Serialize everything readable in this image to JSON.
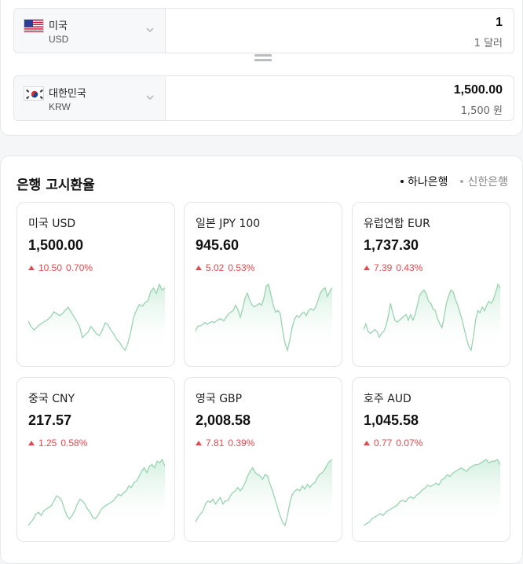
{
  "converter": {
    "from": {
      "name": "미국",
      "code": "USD",
      "flag": "us-flag-icon",
      "amount": "1",
      "amount_text": "1 달러"
    },
    "to": {
      "name": "대한민국",
      "code": "KRW",
      "flag": "kr-flag-icon",
      "amount": "1,500.00",
      "amount_text": "1,500 원"
    }
  },
  "rates": {
    "title": "은행 고시환율",
    "banks": [
      {
        "label": "하나은행",
        "active": true
      },
      {
        "label": "신한은행",
        "active": false
      }
    ],
    "cards": [
      {
        "name": "미국 USD",
        "value": "1,500.00",
        "change": "10.50",
        "pct": "0.70%",
        "series": [
          40,
          34,
          30,
          33,
          36,
          38,
          40,
          42,
          45,
          50,
          48,
          46,
          48,
          52,
          55,
          50,
          45,
          40,
          34,
          22,
          25,
          28,
          34,
          30,
          26,
          24,
          30,
          38,
          36,
          30,
          26,
          20,
          17,
          12,
          8,
          16,
          28,
          44,
          52,
          58,
          56,
          60,
          62,
          72,
          76,
          70,
          80,
          74,
          76
        ]
      },
      {
        "name": "일본 JPY 100",
        "value": "945.60",
        "change": "5.02",
        "pct": "0.53%",
        "series": [
          30,
          36,
          36,
          38,
          40,
          38,
          40,
          41,
          40,
          42,
          44,
          44,
          42,
          46,
          50,
          52,
          54,
          60,
          55,
          46,
          56,
          68,
          74,
          66,
          60,
          58,
          60,
          62,
          60,
          68,
          82,
          84,
          72,
          60,
          52,
          54,
          50,
          30,
          16,
          8,
          20,
          34,
          44,
          48,
          46,
          50,
          52,
          48,
          54,
          56,
          54,
          58,
          66,
          74,
          78,
          80,
          70,
          76,
          80
        ]
      },
      {
        "name": "유럽연합 EUR",
        "value": "1,737.30",
        "change": "7.39",
        "pct": "0.43%",
        "series": [
          30,
          36,
          28,
          26,
          28,
          30,
          28,
          22,
          26,
          28,
          34,
          44,
          58,
          48,
          40,
          38,
          40,
          42,
          44,
          46,
          40,
          46,
          40,
          46,
          56,
          66,
          70,
          72,
          68,
          60,
          58,
          52,
          50,
          42,
          36,
          32,
          44,
          58,
          66,
          72,
          70,
          62,
          56,
          48,
          40,
          30,
          20,
          12,
          8,
          22,
          40,
          50,
          48,
          54,
          50,
          56,
          60,
          58,
          62,
          70,
          78,
          74
        ]
      },
      {
        "name": "중국 CNY",
        "value": "217.57",
        "change": "1.25",
        "pct": "0.58%",
        "series": [
          8,
          12,
          16,
          22,
          24,
          20,
          26,
          28,
          30,
          32,
          38,
          44,
          42,
          38,
          28,
          20,
          16,
          20,
          26,
          34,
          40,
          38,
          34,
          28,
          24,
          18,
          16,
          20,
          26,
          30,
          32,
          34,
          36,
          38,
          42,
          46,
          44,
          48,
          50,
          56,
          54,
          60,
          62,
          68,
          74,
          78,
          72,
          80,
          82,
          78,
          86,
          84,
          88,
          80
        ]
      },
      {
        "name": "영국 GBP",
        "value": "2,008.58",
        "change": "7.81",
        "pct": "0.39%",
        "series": [
          14,
          20,
          24,
          28,
          36,
          40,
          38,
          42,
          36,
          40,
          44,
          36,
          40,
          40,
          46,
          50,
          52,
          56,
          52,
          56,
          62,
          70,
          76,
          80,
          74,
          72,
          70,
          66,
          72,
          70,
          60,
          52,
          42,
          32,
          22,
          14,
          10,
          22,
          38,
          48,
          52,
          54,
          52,
          58,
          54,
          60,
          56,
          60,
          62,
          68,
          72,
          74,
          78,
          84,
          88,
          90
        ]
      },
      {
        "name": "호주 AUD",
        "value": "1,045.58",
        "change": "0.77",
        "pct": "0.07%",
        "series": [
          12,
          14,
          16,
          20,
          22,
          24,
          26,
          24,
          28,
          30,
          32,
          34,
          36,
          40,
          42,
          40,
          44,
          46,
          44,
          48,
          50,
          54,
          56,
          60,
          58,
          60,
          62,
          60,
          66,
          68,
          72,
          70,
          74,
          76,
          78,
          80,
          78,
          76,
          80,
          82,
          84,
          84,
          86,
          88,
          90,
          86,
          88,
          88,
          90,
          84
        ]
      }
    ]
  },
  "colors": {
    "up": "#e5484d",
    "spark_line": "#9ad3b2",
    "spark_fill_top": "#cfeedd"
  }
}
